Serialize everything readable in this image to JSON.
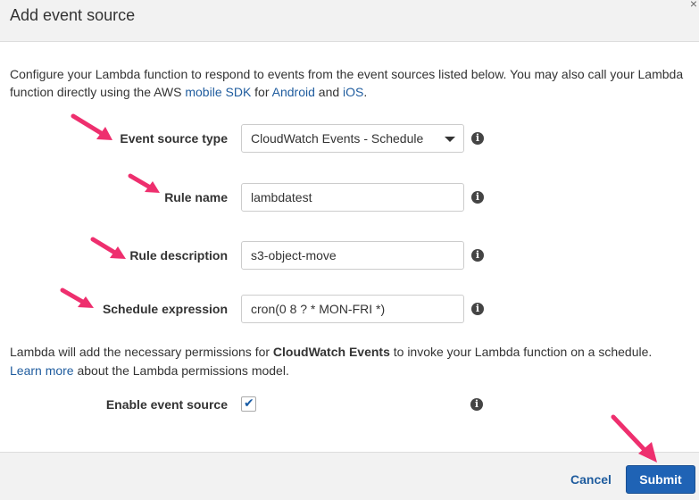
{
  "dialog": {
    "title": "Add event source",
    "close_symbol": "×"
  },
  "intro": {
    "text_1": "Configure your Lambda function to respond to events from the event sources listed below. You may also call your Lambda function directly using the AWS ",
    "link_mobile_sdk": "mobile SDK",
    "text_2": " for ",
    "link_android": "Android",
    "text_3": " and ",
    "link_ios": "iOS",
    "text_4": "."
  },
  "form": {
    "event_source_type": {
      "label": "Event source type",
      "value": "CloudWatch Events - Schedule"
    },
    "rule_name": {
      "label": "Rule name",
      "value": "lambdatest"
    },
    "rule_description": {
      "label": "Rule description",
      "value": "s3-object-move"
    },
    "schedule_expression": {
      "label": "Schedule expression",
      "value": "cron(0 8 ? * MON-FRI *)"
    },
    "enable_event_source": {
      "label": "Enable event source",
      "checked": true,
      "check_symbol": "✔"
    },
    "info_symbol": "i"
  },
  "permissions": {
    "text_1": "Lambda will add the necessary permissions for ",
    "bold": "CloudWatch Events",
    "text_2": " to invoke your Lambda function on a schedule.",
    "link_learn_more": "Learn more",
    "text_3": " about the Lambda permissions model."
  },
  "footer": {
    "cancel_label": "Cancel",
    "submit_label": "Submit"
  },
  "colors": {
    "link": "#1f5c9e",
    "primary_button": "#1f63b5",
    "annotation_arrow": "#ee2f6e"
  },
  "icons": [
    "close-icon",
    "info-icon",
    "checkmark-icon",
    "dropdown-chevron-icon",
    "annotation-arrow-icon"
  ]
}
